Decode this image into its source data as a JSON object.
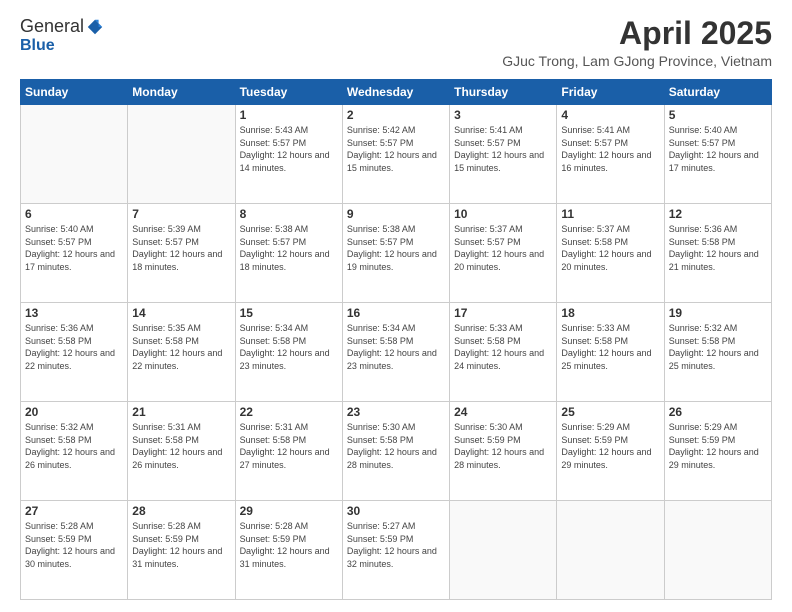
{
  "header": {
    "logo_general": "General",
    "logo_blue": "Blue",
    "month_title": "April 2025",
    "location": "GJuc Trong, Lam GJong Province, Vietnam"
  },
  "calendar": {
    "days_of_week": [
      "Sunday",
      "Monday",
      "Tuesday",
      "Wednesday",
      "Thursday",
      "Friday",
      "Saturday"
    ],
    "weeks": [
      [
        {
          "day": "",
          "sunrise": "",
          "sunset": "",
          "daylight": "",
          "empty": true
        },
        {
          "day": "",
          "sunrise": "",
          "sunset": "",
          "daylight": "",
          "empty": true
        },
        {
          "day": "1",
          "sunrise": "Sunrise: 5:43 AM",
          "sunset": "Sunset: 5:57 PM",
          "daylight": "Daylight: 12 hours and 14 minutes.",
          "empty": false
        },
        {
          "day": "2",
          "sunrise": "Sunrise: 5:42 AM",
          "sunset": "Sunset: 5:57 PM",
          "daylight": "Daylight: 12 hours and 15 minutes.",
          "empty": false
        },
        {
          "day": "3",
          "sunrise": "Sunrise: 5:41 AM",
          "sunset": "Sunset: 5:57 PM",
          "daylight": "Daylight: 12 hours and 15 minutes.",
          "empty": false
        },
        {
          "day": "4",
          "sunrise": "Sunrise: 5:41 AM",
          "sunset": "Sunset: 5:57 PM",
          "daylight": "Daylight: 12 hours and 16 minutes.",
          "empty": false
        },
        {
          "day": "5",
          "sunrise": "Sunrise: 5:40 AM",
          "sunset": "Sunset: 5:57 PM",
          "daylight": "Daylight: 12 hours and 17 minutes.",
          "empty": false
        }
      ],
      [
        {
          "day": "6",
          "sunrise": "Sunrise: 5:40 AM",
          "sunset": "Sunset: 5:57 PM",
          "daylight": "Daylight: 12 hours and 17 minutes.",
          "empty": false
        },
        {
          "day": "7",
          "sunrise": "Sunrise: 5:39 AM",
          "sunset": "Sunset: 5:57 PM",
          "daylight": "Daylight: 12 hours and 18 minutes.",
          "empty": false
        },
        {
          "day": "8",
          "sunrise": "Sunrise: 5:38 AM",
          "sunset": "Sunset: 5:57 PM",
          "daylight": "Daylight: 12 hours and 18 minutes.",
          "empty": false
        },
        {
          "day": "9",
          "sunrise": "Sunrise: 5:38 AM",
          "sunset": "Sunset: 5:57 PM",
          "daylight": "Daylight: 12 hours and 19 minutes.",
          "empty": false
        },
        {
          "day": "10",
          "sunrise": "Sunrise: 5:37 AM",
          "sunset": "Sunset: 5:57 PM",
          "daylight": "Daylight: 12 hours and 20 minutes.",
          "empty": false
        },
        {
          "day": "11",
          "sunrise": "Sunrise: 5:37 AM",
          "sunset": "Sunset: 5:58 PM",
          "daylight": "Daylight: 12 hours and 20 minutes.",
          "empty": false
        },
        {
          "day": "12",
          "sunrise": "Sunrise: 5:36 AM",
          "sunset": "Sunset: 5:58 PM",
          "daylight": "Daylight: 12 hours and 21 minutes.",
          "empty": false
        }
      ],
      [
        {
          "day": "13",
          "sunrise": "Sunrise: 5:36 AM",
          "sunset": "Sunset: 5:58 PM",
          "daylight": "Daylight: 12 hours and 22 minutes.",
          "empty": false
        },
        {
          "day": "14",
          "sunrise": "Sunrise: 5:35 AM",
          "sunset": "Sunset: 5:58 PM",
          "daylight": "Daylight: 12 hours and 22 minutes.",
          "empty": false
        },
        {
          "day": "15",
          "sunrise": "Sunrise: 5:34 AM",
          "sunset": "Sunset: 5:58 PM",
          "daylight": "Daylight: 12 hours and 23 minutes.",
          "empty": false
        },
        {
          "day": "16",
          "sunrise": "Sunrise: 5:34 AM",
          "sunset": "Sunset: 5:58 PM",
          "daylight": "Daylight: 12 hours and 23 minutes.",
          "empty": false
        },
        {
          "day": "17",
          "sunrise": "Sunrise: 5:33 AM",
          "sunset": "Sunset: 5:58 PM",
          "daylight": "Daylight: 12 hours and 24 minutes.",
          "empty": false
        },
        {
          "day": "18",
          "sunrise": "Sunrise: 5:33 AM",
          "sunset": "Sunset: 5:58 PM",
          "daylight": "Daylight: 12 hours and 25 minutes.",
          "empty": false
        },
        {
          "day": "19",
          "sunrise": "Sunrise: 5:32 AM",
          "sunset": "Sunset: 5:58 PM",
          "daylight": "Daylight: 12 hours and 25 minutes.",
          "empty": false
        }
      ],
      [
        {
          "day": "20",
          "sunrise": "Sunrise: 5:32 AM",
          "sunset": "Sunset: 5:58 PM",
          "daylight": "Daylight: 12 hours and 26 minutes.",
          "empty": false
        },
        {
          "day": "21",
          "sunrise": "Sunrise: 5:31 AM",
          "sunset": "Sunset: 5:58 PM",
          "daylight": "Daylight: 12 hours and 26 minutes.",
          "empty": false
        },
        {
          "day": "22",
          "sunrise": "Sunrise: 5:31 AM",
          "sunset": "Sunset: 5:58 PM",
          "daylight": "Daylight: 12 hours and 27 minutes.",
          "empty": false
        },
        {
          "day": "23",
          "sunrise": "Sunrise: 5:30 AM",
          "sunset": "Sunset: 5:58 PM",
          "daylight": "Daylight: 12 hours and 28 minutes.",
          "empty": false
        },
        {
          "day": "24",
          "sunrise": "Sunrise: 5:30 AM",
          "sunset": "Sunset: 5:59 PM",
          "daylight": "Daylight: 12 hours and 28 minutes.",
          "empty": false
        },
        {
          "day": "25",
          "sunrise": "Sunrise: 5:29 AM",
          "sunset": "Sunset: 5:59 PM",
          "daylight": "Daylight: 12 hours and 29 minutes.",
          "empty": false
        },
        {
          "day": "26",
          "sunrise": "Sunrise: 5:29 AM",
          "sunset": "Sunset: 5:59 PM",
          "daylight": "Daylight: 12 hours and 29 minutes.",
          "empty": false
        }
      ],
      [
        {
          "day": "27",
          "sunrise": "Sunrise: 5:28 AM",
          "sunset": "Sunset: 5:59 PM",
          "daylight": "Daylight: 12 hours and 30 minutes.",
          "empty": false
        },
        {
          "day": "28",
          "sunrise": "Sunrise: 5:28 AM",
          "sunset": "Sunset: 5:59 PM",
          "daylight": "Daylight: 12 hours and 31 minutes.",
          "empty": false
        },
        {
          "day": "29",
          "sunrise": "Sunrise: 5:28 AM",
          "sunset": "Sunset: 5:59 PM",
          "daylight": "Daylight: 12 hours and 31 minutes.",
          "empty": false
        },
        {
          "day": "30",
          "sunrise": "Sunrise: 5:27 AM",
          "sunset": "Sunset: 5:59 PM",
          "daylight": "Daylight: 12 hours and 32 minutes.",
          "empty": false
        },
        {
          "day": "",
          "sunrise": "",
          "sunset": "",
          "daylight": "",
          "empty": true
        },
        {
          "day": "",
          "sunrise": "",
          "sunset": "",
          "daylight": "",
          "empty": true
        },
        {
          "day": "",
          "sunrise": "",
          "sunset": "",
          "daylight": "",
          "empty": true
        }
      ]
    ]
  }
}
